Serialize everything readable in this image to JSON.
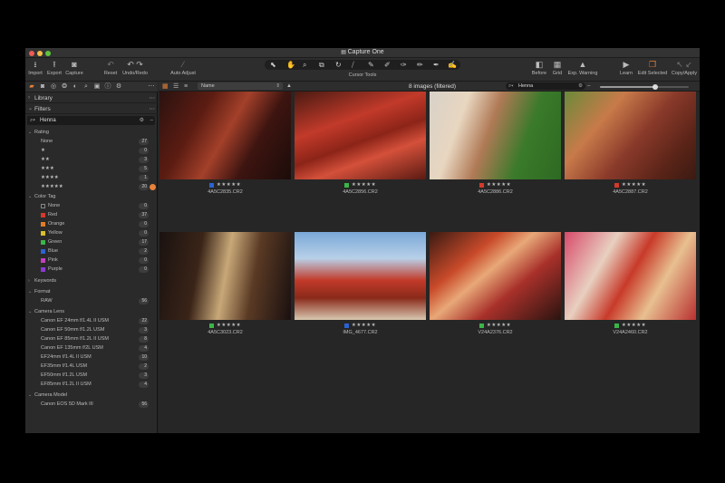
{
  "window": {
    "title": "Capture One"
  },
  "toolbar": {
    "left": [
      {
        "label": "Import",
        "icon": "import-icon"
      },
      {
        "label": "Export",
        "icon": "export-icon"
      },
      {
        "label": "Capture",
        "icon": "camera-icon"
      }
    ],
    "reset_label": "Reset",
    "undo_redo_label": "Undo/Redo",
    "auto_adjust_label": "Auto Adjust",
    "cursor_tools_label": "Cursor Tools",
    "right": [
      {
        "label": "Before",
        "icon": "before-icon"
      },
      {
        "label": "Grid",
        "icon": "grid-icon"
      },
      {
        "label": "Exp. Warning",
        "icon": "exposure-warning-icon"
      },
      {
        "label": "Learn",
        "icon": "learn-icon"
      },
      {
        "label": "Edit Selected",
        "icon": "edit-selected-icon"
      },
      {
        "label": "Copy/Apply",
        "icon": "copy-apply-icon"
      }
    ]
  },
  "sidebar": {
    "library_label": "Library",
    "filters_label": "Filters",
    "search_value": "Henna",
    "rating": {
      "title": "Rating",
      "items": [
        {
          "label": "None",
          "count": "27"
        },
        {
          "label": "★",
          "count": "0"
        },
        {
          "label": "★★",
          "count": "3"
        },
        {
          "label": "★★★",
          "count": "5"
        },
        {
          "label": "★★★★",
          "count": "1"
        },
        {
          "label": "★★★★★",
          "count": "20"
        }
      ]
    },
    "color_tag": {
      "title": "Color Tag",
      "items": [
        {
          "label": "None",
          "count": "0",
          "color": "#2a2a2a"
        },
        {
          "label": "Red",
          "count": "37",
          "color": "#d33a2c"
        },
        {
          "label": "Orange",
          "count": "0",
          "color": "#e07b26"
        },
        {
          "label": "Yellow",
          "count": "0",
          "color": "#d8c02a"
        },
        {
          "label": "Green",
          "count": "17",
          "color": "#3bb54a"
        },
        {
          "label": "Blue",
          "count": "2",
          "color": "#2b63d1"
        },
        {
          "label": "Pink",
          "count": "0",
          "color": "#c53fbf"
        },
        {
          "label": "Purple",
          "count": "0",
          "color": "#8a3ad1"
        }
      ]
    },
    "keywords_label": "Keywords",
    "format": {
      "title": "Format",
      "items": [
        {
          "label": "RAW",
          "count": "56"
        }
      ]
    },
    "camera_lens": {
      "title": "Camera Lens",
      "items": [
        {
          "label": "Canon EF 24mm f/1.4L II USM",
          "count": "22"
        },
        {
          "label": "Canon EF 50mm f/1.2L USM",
          "count": "3"
        },
        {
          "label": "Canon EF 85mm f/1.2L II USM",
          "count": "8"
        },
        {
          "label": "Canon EF 135mm f/2L USM",
          "count": "4"
        },
        {
          "label": "EF24mm f/1.4L II USM",
          "count": "10"
        },
        {
          "label": "EF35mm f/1.4L USM",
          "count": "2"
        },
        {
          "label": "EF50mm f/1.2L USM",
          "count": "3"
        },
        {
          "label": "EF85mm f/1.2L II USM",
          "count": "4"
        }
      ]
    },
    "camera_model": {
      "title": "Camera Model",
      "items": [
        {
          "label": "Canon EOS 5D Mark III",
          "count": "56"
        }
      ]
    }
  },
  "browser_bar": {
    "sort_value": "Name",
    "count_label": "8 images (filtered)",
    "search_value": "Henna",
    "zoom_level": 0.62
  },
  "images": [
    {
      "filename": "4A5C2835.CR2",
      "tag_color": "#2b63d1",
      "stars": "★★★★★"
    },
    {
      "filename": "4A5C2856.CR2",
      "tag_color": "#3bb54a",
      "stars": "★★★★★"
    },
    {
      "filename": "4A5C2886.CR2",
      "tag_color": "#d33a2c",
      "stars": "★★★★★"
    },
    {
      "filename": "4A5C2887.CR2",
      "tag_color": "#d33a2c",
      "stars": "★★★★★"
    },
    {
      "filename": "4A5C3023.CR2",
      "tag_color": "#3bb54a",
      "stars": "★★★★★"
    },
    {
      "filename": "IMG_4677.CR2",
      "tag_color": "#2b63d1",
      "stars": "★★★★★"
    },
    {
      "filename": "V24A2376.CR2",
      "tag_color": "#3bb54a",
      "stars": "★★★★★"
    },
    {
      "filename": "V24A2460.CR2",
      "tag_color": "#3bb54a",
      "stars": "★★★★★"
    }
  ]
}
